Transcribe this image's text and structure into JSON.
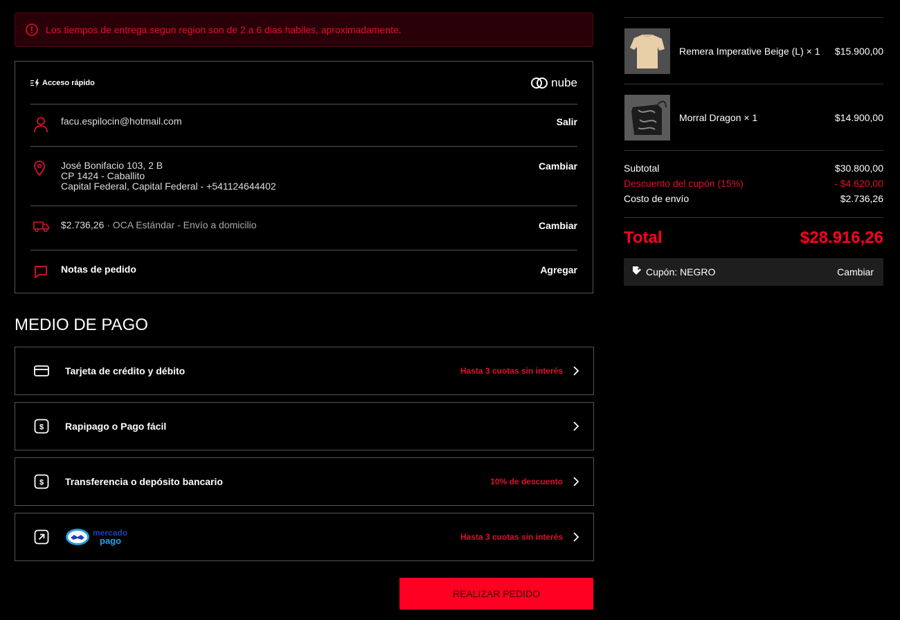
{
  "alert": {
    "text": "Los tiempos de entrega segun region son de 2 a 6 dias habiles, aproximadamente."
  },
  "quick_access": {
    "label": "Acceso rápido",
    "brand": "nube"
  },
  "contact": {
    "email": "facu.espilocin@hotmail.com",
    "action": "Salir"
  },
  "address": {
    "line1": "José Bonifacio 103, 2 B",
    "line2": "CP 1424 - Caballito",
    "line3": "Capital Federal, Capital Federal - +541124644402",
    "action": "Cambiar"
  },
  "shipping": {
    "price": "$2.736,26",
    "separator": "·",
    "method": "OCA Estándar - Envío a domicilio",
    "action": "Cambiar"
  },
  "notes": {
    "label": "Notas de pedido",
    "action": "Agregar"
  },
  "payment": {
    "title": "MEDIO DE PAGO",
    "methods": [
      {
        "label": "Tarjeta de crédito y débito",
        "note": "Hasta 3 cuotas sin interés"
      },
      {
        "label": "Rapipago o Pago fácil",
        "note": ""
      },
      {
        "label": "Transferencia o depósito bancario",
        "note": "10% de descuento"
      },
      {
        "label": "",
        "logo_line1": "mercado",
        "logo_line2": "pago",
        "note": "Hasta 3 cuotas sin interés"
      }
    ]
  },
  "submit_label": "REALIZAR PEDIDO",
  "cart": {
    "items": [
      {
        "name": "Remera Imperative Beige (L) × 1",
        "price": "$15.900,00"
      },
      {
        "name": "Morral Dragon × 1",
        "price": "$14.900,00"
      }
    ],
    "subtotal_label": "Subtotal",
    "subtotal": "$30.800,00",
    "discount_label": "Descuento del cupón (15%)",
    "discount": "- $4.620,00",
    "shipping_label": "Costo de envío",
    "shipping": "$2.736,26",
    "total_label": "Total",
    "total": "$28.916,26",
    "coupon_label": "Cupón: NEGRO",
    "coupon_action": "Cambiar"
  },
  "colors": {
    "accent": "#ff0022",
    "alert_text": "#e0102e",
    "alert_bg": "#2a0008",
    "border": "#555555"
  }
}
